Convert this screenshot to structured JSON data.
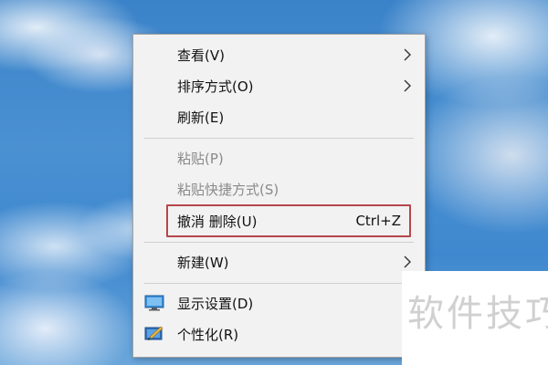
{
  "menu": {
    "items": [
      {
        "label": "查看(V)",
        "has_submenu": true,
        "enabled": true
      },
      {
        "label": "排序方式(O)",
        "has_submenu": true,
        "enabled": true
      },
      {
        "label": "刷新(E)",
        "has_submenu": false,
        "enabled": true
      },
      {
        "label": "粘贴(P)",
        "has_submenu": false,
        "enabled": false
      },
      {
        "label": "粘贴快捷方式(S)",
        "has_submenu": false,
        "enabled": false
      },
      {
        "label": "撤消 删除(U)",
        "shortcut": "Ctrl+Z",
        "has_submenu": false,
        "enabled": true,
        "highlighted": true
      },
      {
        "label": "新建(W)",
        "has_submenu": true,
        "enabled": true
      },
      {
        "label": "显示设置(D)",
        "icon": "display-settings-icon",
        "has_submenu": false,
        "enabled": true
      },
      {
        "label": "个性化(R)",
        "icon": "personalize-icon",
        "has_submenu": false,
        "enabled": true
      }
    ]
  },
  "watermark": {
    "text": "软件技巧"
  },
  "colors": {
    "menu_background": "#f2f2f2",
    "highlight_border": "#b5474b",
    "disabled_text": "#8a8a8a",
    "sky_blue": "#3f88cf"
  }
}
